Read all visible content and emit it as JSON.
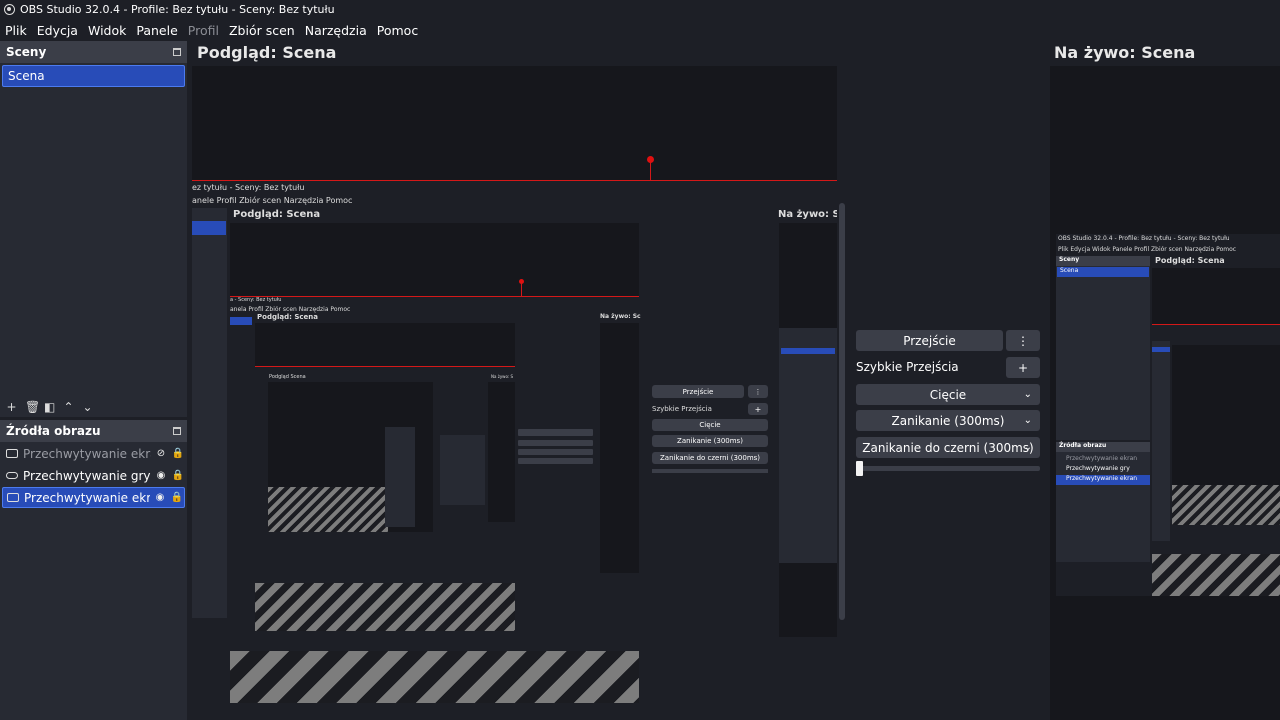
{
  "window": {
    "title": "OBS Studio 32.0.4 - Profile: Bez tytułu - Sceny: Bez tytułu"
  },
  "menu": [
    {
      "label": "Plik",
      "disabled": false
    },
    {
      "label": "Edycja",
      "disabled": false
    },
    {
      "label": "Widok",
      "disabled": false
    },
    {
      "label": "Panele",
      "disabled": false
    },
    {
      "label": "Profil",
      "disabled": true
    },
    {
      "label": "Zbiór scen",
      "disabled": false
    },
    {
      "label": "Narzędzia",
      "disabled": false
    },
    {
      "label": "Pomoc",
      "disabled": false
    }
  ],
  "scenes": {
    "header": "Sceny",
    "items": [
      "Scena"
    ],
    "toolbar_icons": [
      "add-icon",
      "trash-icon",
      "filter-icon",
      "up-icon",
      "down-icon"
    ]
  },
  "sources": {
    "header": "Źródła obrazu",
    "items": [
      {
        "label": "Przechwytywanie ekranu",
        "icon": "monitor-icon",
        "visible": false,
        "selected": false
      },
      {
        "label": "Przechwytywanie gry",
        "icon": "gamepad-icon",
        "visible": true,
        "selected": false
      },
      {
        "label": "Przechwytywanie ekranu",
        "icon": "monitor-icon",
        "visible": true,
        "selected": true
      }
    ]
  },
  "preview": {
    "title": "Podgląd: Scena"
  },
  "live": {
    "title": "Na żywo: Scena"
  },
  "transitions": {
    "transition_button": "Przejście",
    "quick_label": "Szybkie Przejścia",
    "options": [
      "Cięcie",
      "Zanikanie (300ms)",
      "Zanikanie do czerni (300ms)"
    ]
  },
  "nested": {
    "title": "ez tytułu - Sceny: Bez tytułu",
    "menu": "anele  Profil  Zbiór scen  Narzędzia  Pomoc",
    "preview": "Podgląd: Scena",
    "live": "Na żywo: Sc",
    "live_window_title": "OBS Studio 32.0.4 - Profile: Bez tytułu - Sceny: Bez tytułu",
    "live_menu": "Plik  Edycja  Widok  Panele  Profil  Zbiór scen  Narzędzia  Pomoc",
    "live_scenes": "Sceny",
    "live_scene": "Scena",
    "live_preview": "Podgląd: Scena",
    "live_sources": "Źródła obrazu",
    "live_src1": "Przechwytywanie ekran",
    "live_src2": "Przechwytywanie gry",
    "live_src3": "Przechwytywanie ekran",
    "level2_title": "a - Sceny: Bez tytułu",
    "level2_menu": "anela  Profil  Zbiór scen  Narzędzia  Pomoc",
    "level2_preview": "Podgląd: Scena",
    "level2_live": "Na żywo: Sc",
    "level3_preview": "Podgląd Scena",
    "level3_live": "Na żywo: S"
  },
  "colors": {
    "accent": "#284cb8",
    "accent_border": "#4c7bef",
    "bg": "#1d1f26",
    "panel": "#272a33",
    "button": "#3b3e48",
    "red_guide": "#d41818"
  }
}
